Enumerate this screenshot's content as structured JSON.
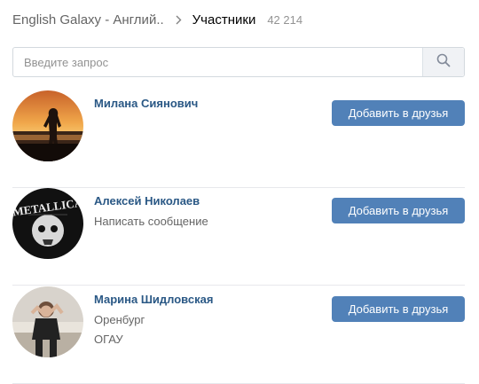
{
  "header": {
    "group_name": "English Galaxy - Англий..",
    "section": "Участники",
    "count": "42 214"
  },
  "search": {
    "placeholder": "Введите запрос",
    "icon": "search-icon"
  },
  "members": [
    {
      "name": "Милана Сиянович",
      "line2": "",
      "line3": "",
      "button": "Добавить в друзья",
      "avatar": "silhouette-sunset"
    },
    {
      "name": "Алексей Николаев",
      "line2": "Написать сообщение",
      "line3": "",
      "button": "Добавить в друзья",
      "avatar": "metallica-logo"
    },
    {
      "name": "Марина Шидловская",
      "line2": "Оренбург",
      "line3": "ОГАУ",
      "button": "Добавить в друзья",
      "avatar": "girl-photo"
    }
  ],
  "colors": {
    "link": "#2a5885",
    "button": "#5181b8",
    "divider": "#e7e8ec"
  }
}
